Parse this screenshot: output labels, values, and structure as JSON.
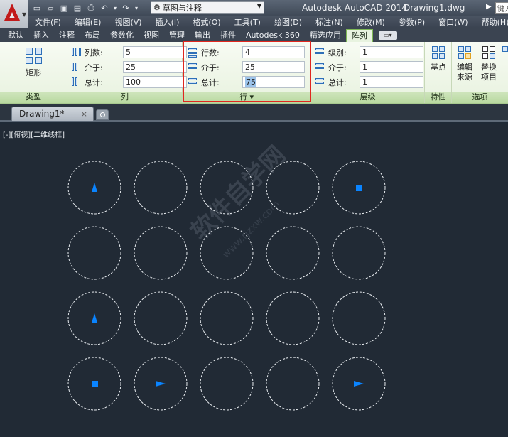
{
  "titlebar": {
    "workspace": "草图与注释",
    "app_title": "Autodesk AutoCAD 2014",
    "file_name": "Drawing1.dwg",
    "search_placeholder": "键入"
  },
  "menu": [
    "文件(F)",
    "编辑(E)",
    "视图(V)",
    "插入(I)",
    "格式(O)",
    "工具(T)",
    "绘图(D)",
    "标注(N)",
    "修改(M)",
    "参数(P)",
    "窗口(W)",
    "帮助(H)"
  ],
  "ribbon_tabs": [
    "默认",
    "插入",
    "注释",
    "布局",
    "参数化",
    "视图",
    "管理",
    "输出",
    "插件",
    "Autodesk 360",
    "精选应用",
    "阵列"
  ],
  "active_tab": "阵列",
  "panels": {
    "type": {
      "title": "类型",
      "button": "矩形"
    },
    "columns": {
      "title": "列",
      "count_label": "列数:",
      "count_value": "5",
      "between_label": "介于:",
      "between_value": "25",
      "total_label": "总计:",
      "total_value": "100"
    },
    "rows": {
      "title": "行",
      "title_arrow": "▾",
      "count_label": "行数:",
      "count_value": "4",
      "between_label": "介于:",
      "between_value": "25",
      "total_label": "总计:",
      "total_value": "75"
    },
    "levels": {
      "title": "层级",
      "count_label": "级别:",
      "count_value": "1",
      "between_label": "介于:",
      "between_value": "1",
      "total_label": "总计:",
      "total_value": "1"
    },
    "properties": {
      "title": "特性",
      "button": "基点"
    },
    "options": {
      "title": "选项",
      "edit_source": [
        "编辑",
        "来源"
      ],
      "replace_item": [
        "替换",
        "项目"
      ]
    }
  },
  "document_tab": {
    "label": "Drawing1*",
    "close": "×"
  },
  "viewport_label": "[-][俯视][二维线框]",
  "watermark": {
    "main": "软件自学网",
    "sub": "www.rjzxw.com"
  },
  "colors": {
    "accent": "#0a84ff",
    "canvas_bg": "#212a35",
    "highlight": "#e0271f"
  },
  "grid": {
    "rows": 4,
    "columns": 5
  },
  "markers": [
    {
      "row": 0,
      "col": 0,
      "shape": "triangle-up"
    },
    {
      "row": 0,
      "col": 4,
      "shape": "square"
    },
    {
      "row": 2,
      "col": 0,
      "shape": "triangle-up"
    },
    {
      "row": 3,
      "col": 0,
      "shape": "square"
    },
    {
      "row": 3,
      "col": 1,
      "shape": "triangle-right"
    },
    {
      "row": 3,
      "col": 4,
      "shape": "triangle-right"
    }
  ]
}
